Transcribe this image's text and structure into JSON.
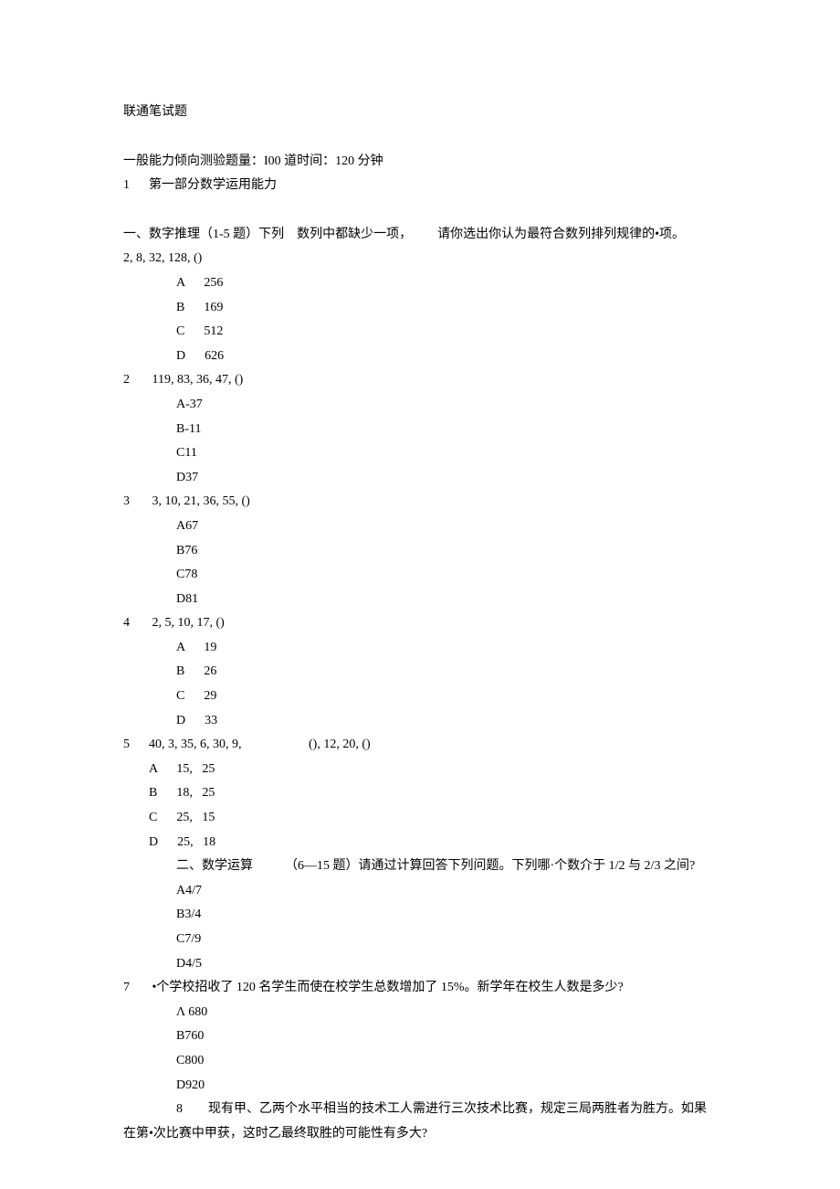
{
  "title": "联通笔试题",
  "intro": "一般能力倾向测验题量：I00 道时间：120 分钟",
  "part1_line1": "1      第一部分数学运用能力",
  "sec1_header": "一、数字推理（1-5 题）下列    数列中都缺少一项，        请你选出你认为最符合数列排列规律的•项。",
  "q1": {
    "stem": "2, 8, 32, 128, ()",
    "a": "A      256",
    "b": "B      169",
    "c": "C      512",
    "d": "D      626"
  },
  "q2": {
    "stem": "2       119, 83, 36, 47, ()",
    "a": "A-37",
    "b": "B-11",
    "c": "C11",
    "d": "D37"
  },
  "q3": {
    "stem": "3       3, 10, 21, 36, 55, ()",
    "a": "A67",
    "b": "B76",
    "c": "C78",
    "d": "D81"
  },
  "q4": {
    "stem": "4       2, 5, 10, 17, ()",
    "a": "A      19",
    "b": "B      26",
    "c": "C      29",
    "d": "D      33"
  },
  "q5": {
    "stem": "5      40, 3, 35, 6, 30, 9,                     (), 12, 20, ()",
    "a": "A      15,   25",
    "b": "B      18,   25",
    "c": "C      25,   15",
    "d": "D      25,   18"
  },
  "sec2_header": "二、数学运算          （6—15 题）请通过计算回答下列问题。下列哪·个数介于 1/2 与 2/3 之间?",
  "q6": {
    "a": "A4/7",
    "b": "B3/4",
    "c": "C7/9",
    "d": "D4/5"
  },
  "q7": {
    "stem": "7       •个学校招收了 120 名学生而使在校学生总数增加了 15%。新学年在校生人数是多少?",
    "a": "Λ 680",
    "b": "B760",
    "c": "C800",
    "d": "D920"
  },
  "q8": {
    "stem1": "8        现有甲、乙两个水平相当的技术工人需进行三次技术比赛，规定三局两胜者为胜方。如果",
    "stem2": "在第•次比赛中甲获，这时乙最终取胜的可能性有多大?"
  }
}
